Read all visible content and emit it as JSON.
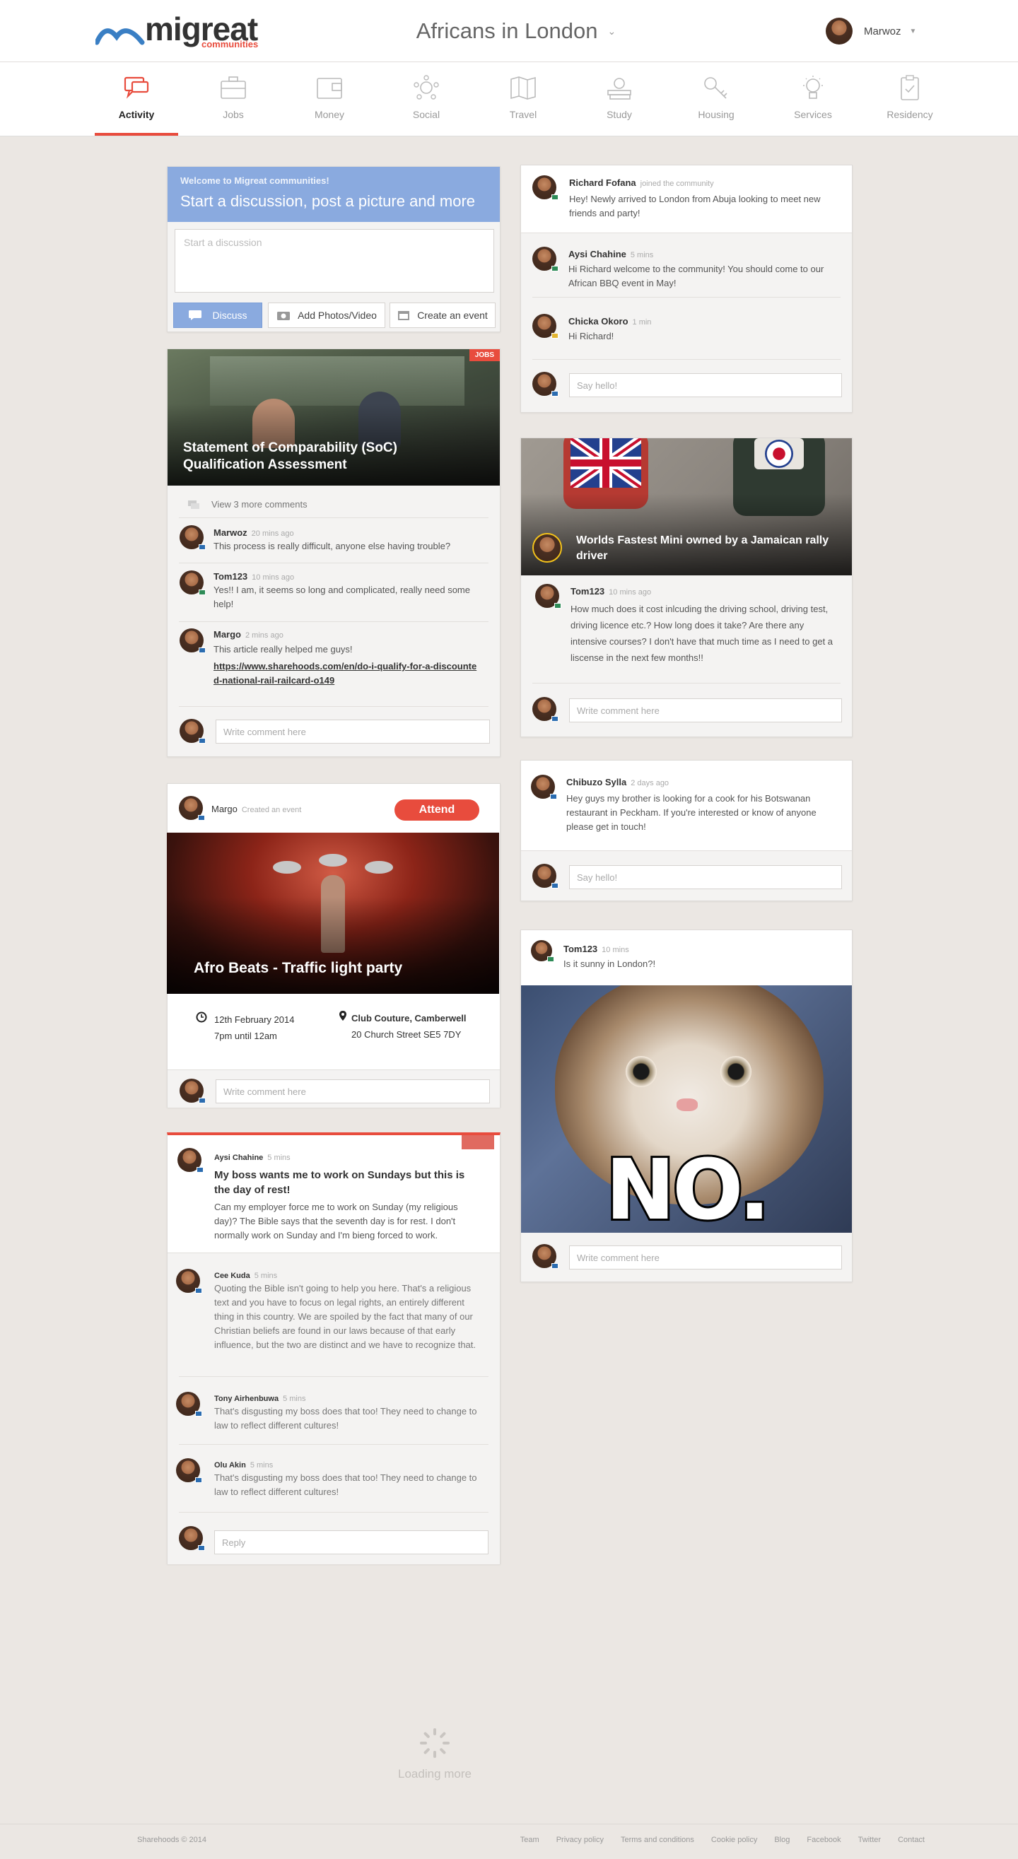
{
  "brand": {
    "name": "migreat",
    "tagline": "communities",
    "accent": "#e84c3d",
    "blue": "#8aaadf"
  },
  "header": {
    "community": "Africans in London",
    "user_name": "Marwoz"
  },
  "nav": [
    {
      "label": "Activity",
      "icon": "activity-icon",
      "active": true
    },
    {
      "label": "Jobs",
      "icon": "briefcase-icon"
    },
    {
      "label": "Money",
      "icon": "wallet-icon"
    },
    {
      "label": "Social",
      "icon": "social-icon"
    },
    {
      "label": "Travel",
      "icon": "map-icon"
    },
    {
      "label": "Study",
      "icon": "study-icon"
    },
    {
      "label": "Housing",
      "icon": "key-icon"
    },
    {
      "label": "Services",
      "icon": "lightbulb-icon"
    },
    {
      "label": "Residency",
      "icon": "clipboard-icon"
    }
  ],
  "composer": {
    "welcome": "Welcome to Migreat communities!",
    "headline_parts": [
      "Start a ",
      "discussion",
      ", post a ",
      "picture",
      " and more"
    ],
    "placeholder": "Start a discussion",
    "discuss": "Discuss",
    "add_photos": "Add Photos/Video",
    "create_event": "Create an event"
  },
  "jobs_post": {
    "badge": "JOBS",
    "title": "Statement of Comparability (SoC) Qualification Assessment",
    "view_more": "View 3 more comments",
    "comments": [
      {
        "name": "Marwoz",
        "time": "20 mins ago",
        "text": "This process is really difficult, anyone else having trouble?"
      },
      {
        "name": "Tom123",
        "time": "10 mins ago",
        "text": "Yes!! I am, it seems so long and complicated, really need some help!"
      },
      {
        "name": "Margo",
        "time": "2 mins ago",
        "text": "This article really helped me guys!",
        "link": "https://www.sharehoods.com/en/do-i-qualify-for-a-discounted-national-rail-railcard-o149"
      }
    ],
    "reply_placeholder": "Write comment here"
  },
  "event_post": {
    "name": "Margo",
    "action": "Created an event",
    "attend": "Attend",
    "title": "Afro Beats - Traffic light party",
    "date": "12th February 2014",
    "time": "7pm until 12am",
    "venue": "Club Couture, Camberwell",
    "address": "20 Church Street SE5 7DY",
    "reply_placeholder": "Write comment here"
  },
  "discussion_post": {
    "name": "Aysi Chahine",
    "time": "5 mins",
    "title": "My boss wants me to work on Sundays but this is the day of rest!",
    "body": "Can my employer force me to work on Sunday (my religious day)? The Bible says that the seventh day is for rest. I don't normally work on Sunday and I'm bieng forced to work.",
    "comments": [
      {
        "name": "Cee Kuda",
        "time": "5 mins",
        "text": "Quoting the Bible isn't going to help you here. That's a religious text and you have to focus on legal rights, an entirely different thing in this country. We are spoiled by the fact that many of our Christian beliefs are found in our laws because of that early influence, but the two are distinct and we have to recognize that."
      },
      {
        "name": "Tony Airhenbuwa",
        "time": "5 mins",
        "text": "That's disgusting my boss does that too! They need to change to law to reflect different cultures!"
      },
      {
        "name": "Olu Akin",
        "time": "5 mins",
        "text": "That's disgusting my boss does that too! They need to change to law to reflect different cultures!"
      }
    ],
    "reply_placeholder": "Reply"
  },
  "join_post": {
    "name": "Richard Fofana",
    "action": "joined the community",
    "text": "Hey! Newly arrived to London from Abuja looking to meet new friends and party!",
    "comments": [
      {
        "name": "Aysi Chahine",
        "time": "5 mins",
        "text": "Hi Richard welcome to the community! You should come to our African BBQ event in May!"
      },
      {
        "name": "Chicka Okoro",
        "time": "1 min",
        "text": "Hi Richard!"
      }
    ],
    "reply_placeholder": "Say hello!"
  },
  "mini_post": {
    "title": "Worlds Fastest Mini owned by a Jamaican rally driver",
    "comment": {
      "name": "Tom123",
      "time": "10 mins ago",
      "text": "How much does it cost inlcuding the driving school, driving test, driving licence etc.? How long does it take? Are there any intensive courses? I don't have that much time as I need to get a liscense in the next few  months!!"
    },
    "reply_placeholder": "Write comment here"
  },
  "cook_post": {
    "name": "Chibuzo Sylla",
    "time": "2 days ago",
    "text": "Hey guys my brother is looking for a cook for his Botswanan restaurant in Peckham.  If you're interested or know of anyone please get in touch!",
    "reply_placeholder": "Say hello!"
  },
  "cat_post": {
    "name": "Tom123",
    "time": "10 mins",
    "text": "Is it sunny in London?!",
    "image_text": "NO.",
    "reply_placeholder": "Write comment here"
  },
  "loading": "Loading more",
  "footer": {
    "copyright": "Sharehoods © 2014",
    "links": [
      "Team",
      "Privacy policy",
      "Terms and conditions",
      "Cookie policy",
      "Blog",
      "Facebook",
      "Twitter",
      "Contact"
    ]
  }
}
